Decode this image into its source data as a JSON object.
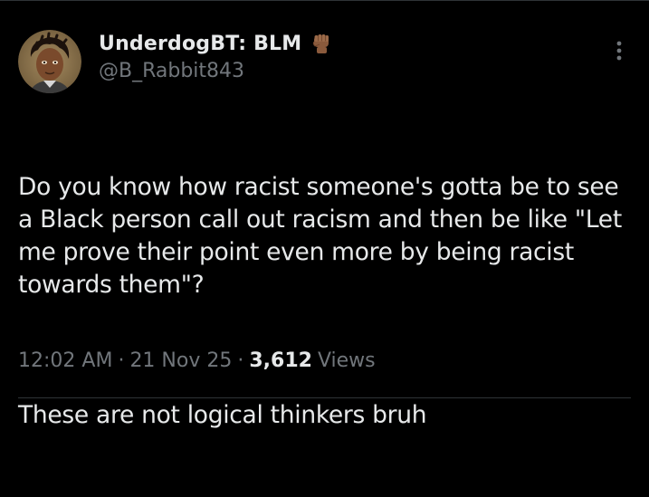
{
  "author": {
    "display_name": "UnderdogBT: BLM",
    "handle": "@B_Rabbit843",
    "badge_icon": "raised-fist-emoji"
  },
  "tweet": {
    "paragraphs": [
      "Do you know how racist someone's gotta be to see a Black person call out racism and then be like \"Let me prove their point even more by being racist towards them\"?",
      "These are not logical thinkers bruh"
    ]
  },
  "meta": {
    "time": "12:02 AM",
    "separator": "·",
    "date": "21 Nov 25",
    "views_count": "3,612",
    "views_label": "Views"
  },
  "icons": {
    "more": "more-vertical-icon"
  },
  "colors": {
    "background": "#000000",
    "text_primary": "#e7e9ea",
    "text_secondary": "#71767b",
    "divider": "#2f3336"
  }
}
